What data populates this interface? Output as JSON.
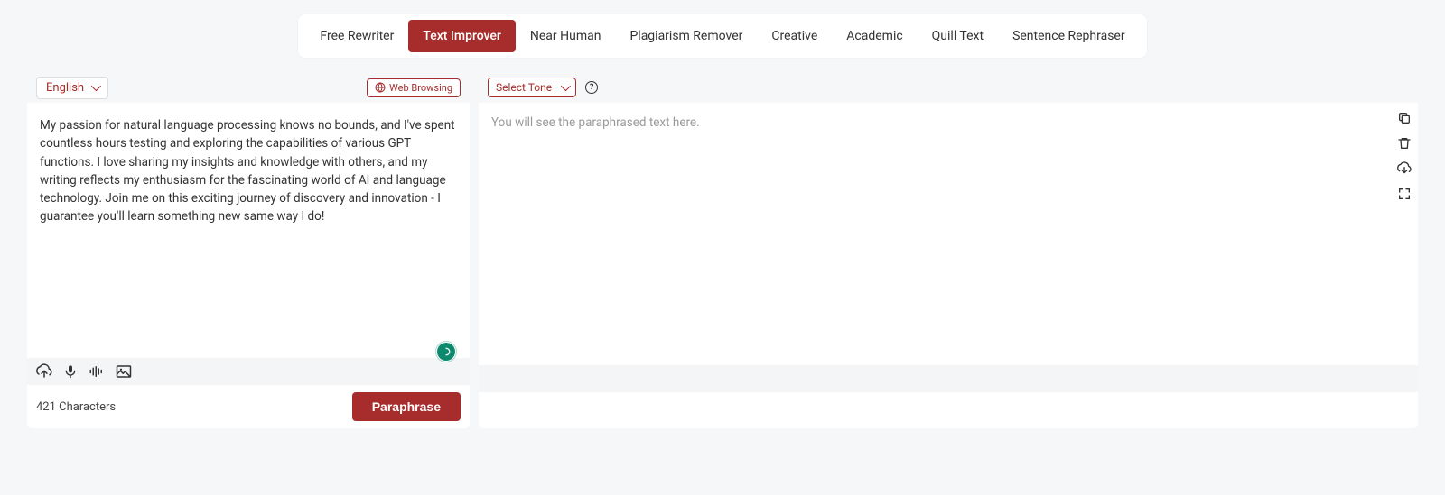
{
  "tabs": [
    {
      "label": "Free Rewriter",
      "active": false
    },
    {
      "label": "Text Improver",
      "active": true
    },
    {
      "label": "Near Human",
      "active": false
    },
    {
      "label": "Plagiarism Remover",
      "active": false
    },
    {
      "label": "Creative",
      "active": false
    },
    {
      "label": "Academic",
      "active": false
    },
    {
      "label": "Quill Text",
      "active": false
    },
    {
      "label": "Sentence Rephraser",
      "active": false
    }
  ],
  "left": {
    "language": "English",
    "web_browsing_label": "Web Browsing",
    "input_text": "My passion for natural language processing knows no bounds, and I've spent countless hours testing and exploring the capabilities of various GPT functions. I love sharing my insights and knowledge with others, and my writing reflects my enthusiasm for the fascinating world of AI and language technology. Join me on this exciting journey of discovery and innovation - I guarantee you'll learn something new same way I do!",
    "char_count_label": "421 Characters",
    "paraphrase_label": "Paraphrase"
  },
  "right": {
    "tone_label": "Select Tone",
    "placeholder": "You will see the paraphrased text here."
  },
  "colors": {
    "primary": "#A72C2C"
  }
}
